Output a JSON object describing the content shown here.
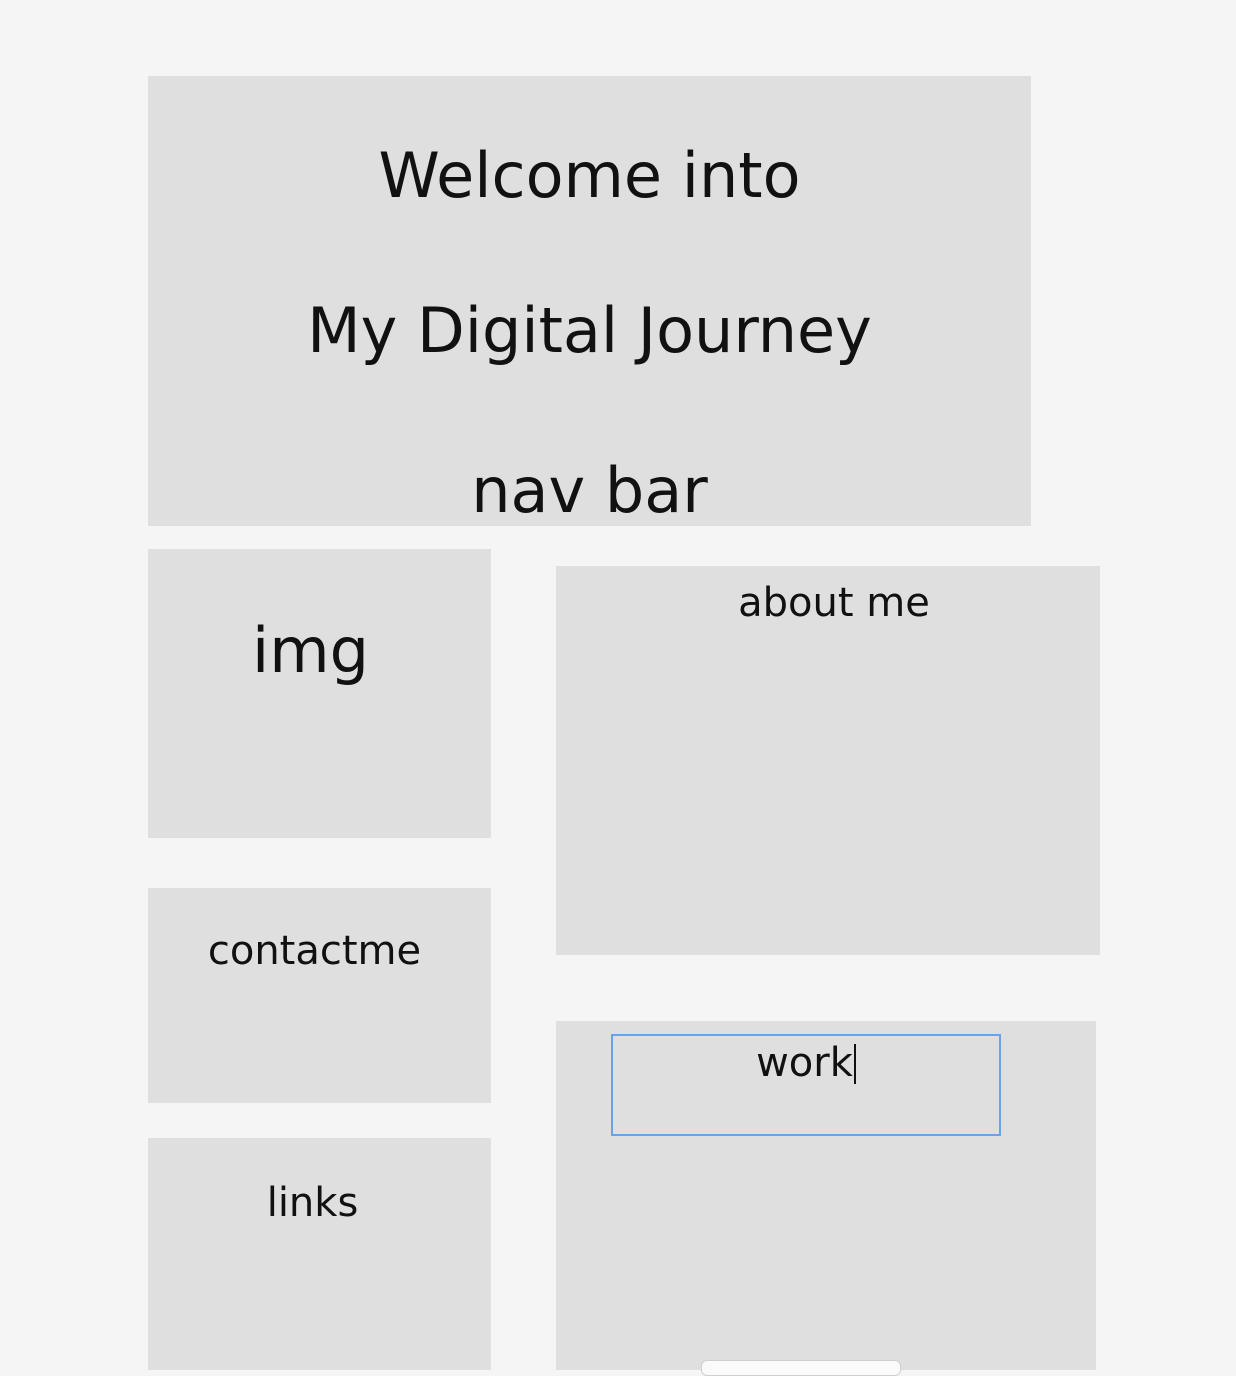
{
  "header": {
    "line1": "Welcome into",
    "line2": "My Digital Journey",
    "line3": "nav bar"
  },
  "img_box": {
    "label": "img"
  },
  "about_box": {
    "label": "about me"
  },
  "contact_box": {
    "label": "contactme"
  },
  "links_box": {
    "label": "links"
  },
  "work_box": {
    "label": "work"
  },
  "colors": {
    "page_background": "#f5f5f5",
    "box_background": "#dfdfdf",
    "selection_border": "#6aa2e6"
  }
}
